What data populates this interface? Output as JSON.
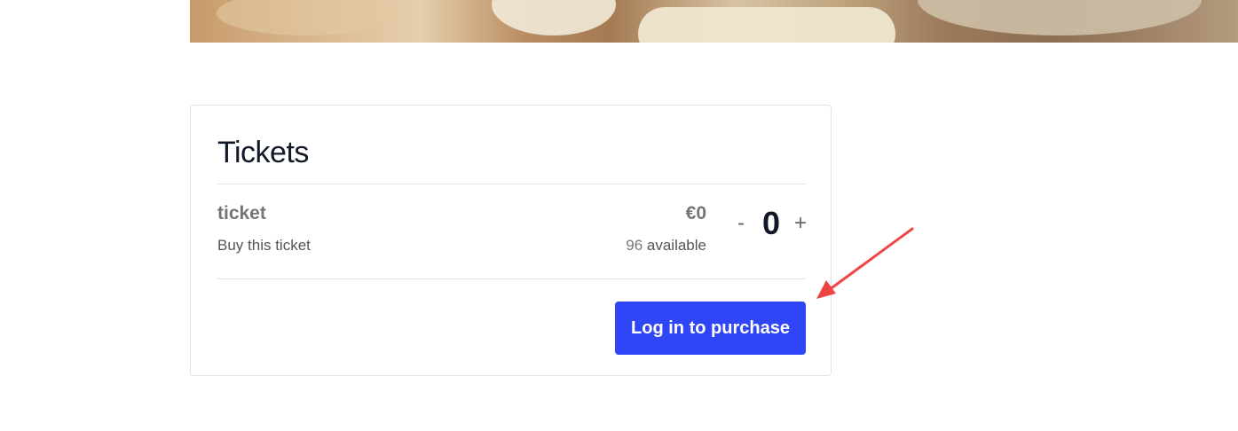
{
  "hero": {
    "alt": "event cover image"
  },
  "tickets": {
    "title": "Tickets",
    "items": [
      {
        "name": "ticket",
        "description": "Buy this ticket",
        "price": "€0",
        "available_count": "96",
        "available_label": "available",
        "quantity": "0",
        "decrement_label": "-",
        "increment_label": "+"
      }
    ],
    "purchase_button_label": "Log in to purchase"
  },
  "colors": {
    "accent": "#3045f5",
    "annotation_arrow": "#ef4444"
  }
}
